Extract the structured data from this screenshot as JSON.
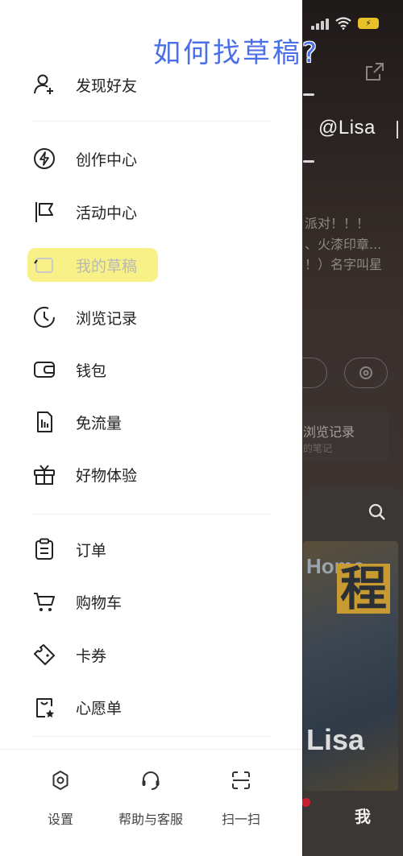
{
  "caption": "如何找草稿?",
  "background": {
    "username": "@Lisa",
    "bio_lines": [
      "派对！！！",
      "、火漆印章...",
      "！）名字叫星"
    ],
    "card_title": "浏览记录",
    "card_subtitle": "的笔记",
    "thumb_top": "Home",
    "thumb_big": "程",
    "thumb_name": "Lisa",
    "tab_me": "我",
    "battery_icon": "battery-charging-icon"
  },
  "menu": {
    "find_friends": "发现好友",
    "creator_center": "创作中心",
    "activity_center": "活动中心",
    "my_drafts": "我的草稿",
    "history": "浏览记录",
    "wallet": "钱包",
    "free_data": "免流量",
    "product_trial": "好物体验",
    "orders": "订单",
    "cart": "购物车",
    "coupons": "卡券",
    "wishlist": "心愿单"
  },
  "footer": {
    "settings": "设置",
    "help": "帮助与客服",
    "scan": "扫一扫"
  },
  "colors": {
    "highlight": "#f6f07a",
    "caption": "#4a6fe8",
    "badge_red": "#c8202e"
  }
}
